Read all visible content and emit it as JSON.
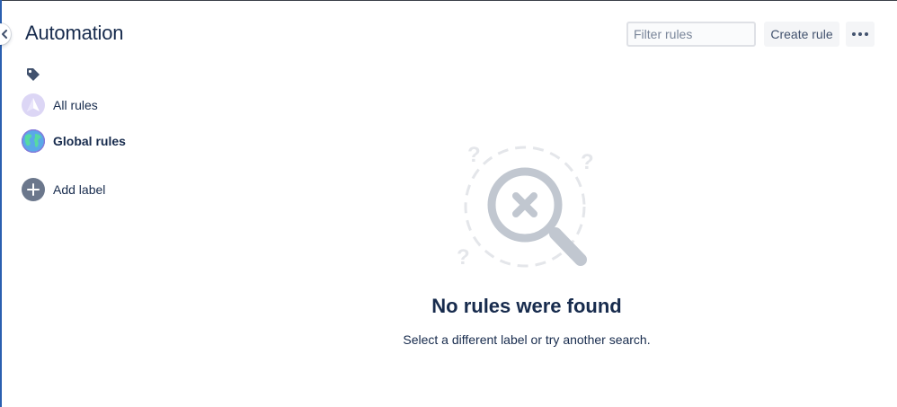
{
  "header": {
    "title": "Automation",
    "filter_placeholder": "Filter rules",
    "filter_value": "",
    "create_label": "Create rule"
  },
  "sidebar": {
    "items": [
      {
        "label": "All rules",
        "icon": "all-rules-icon"
      },
      {
        "label": "Global rules",
        "icon": "globe-icon"
      },
      {
        "label": "Add label",
        "icon": "plus-icon"
      }
    ]
  },
  "empty_state": {
    "title": "No rules were found",
    "description": "Select a different label or try another search."
  },
  "colors": {
    "text": "#172b4d",
    "button_bg": "#f4f5f7",
    "icon_grey": "#6b778c",
    "left_accent": "#2a5fb0"
  }
}
